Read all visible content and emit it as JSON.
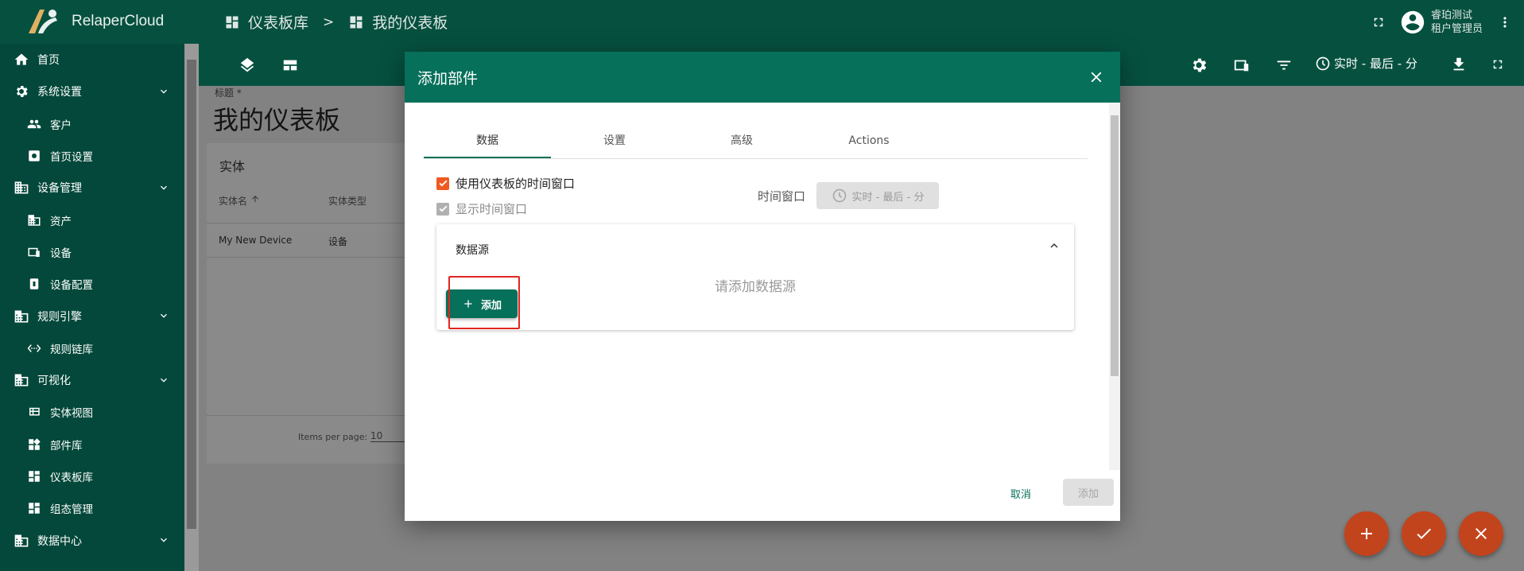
{
  "app": {
    "name": "RelaperCloud"
  },
  "breadcrumb": {
    "root": "仪表板库",
    "separator": ">",
    "current": "我的仪表板"
  },
  "user": {
    "name": "睿珀测试",
    "role": "租户管理员"
  },
  "sidebar": {
    "items": [
      {
        "label": "首页",
        "icon": "home-icon",
        "level": "top"
      },
      {
        "label": "系统设置",
        "icon": "gear-icon",
        "level": "top",
        "expandable": true
      },
      {
        "label": "客户",
        "icon": "people-icon",
        "level": "sub"
      },
      {
        "label": "首页设置",
        "icon": "gear-icon",
        "level": "sub"
      },
      {
        "label": "设备管理",
        "icon": "building-icon",
        "level": "top",
        "expandable": true
      },
      {
        "label": "资产",
        "icon": "building-icon",
        "level": "sub"
      },
      {
        "label": "设备",
        "icon": "devices-icon",
        "level": "sub"
      },
      {
        "label": "设备配置",
        "icon": "device-profile-icon",
        "level": "sub"
      },
      {
        "label": "规则引擎",
        "icon": "building-icon",
        "level": "top",
        "expandable": true
      },
      {
        "label": "规则链库",
        "icon": "code-icon",
        "level": "sub"
      },
      {
        "label": "可视化",
        "icon": "building-icon",
        "level": "top",
        "expandable": true
      },
      {
        "label": "实体视图",
        "icon": "view-icon",
        "level": "sub"
      },
      {
        "label": "部件库",
        "icon": "widgets-icon",
        "level": "sub"
      },
      {
        "label": "仪表板库",
        "icon": "dashboard-icon",
        "level": "sub"
      },
      {
        "label": "组态管理",
        "icon": "dashboard-icon",
        "level": "sub"
      },
      {
        "label": "数据中心",
        "icon": "building-icon",
        "level": "top",
        "expandable": true
      }
    ]
  },
  "dashboard": {
    "title_label": "标题 *",
    "title": "我的仪表板",
    "time_window_button": "实时 - 最后 - 分"
  },
  "entity_card": {
    "title": "实体",
    "columns": [
      "实体名",
      "实体类型"
    ],
    "rows": [
      [
        "My New Device",
        "设备"
      ]
    ],
    "paginator_label": "Items per page:",
    "page_size": "10"
  },
  "dialog": {
    "title": "添加部件",
    "tabs": [
      "数据",
      "设置",
      "高级",
      "Actions"
    ],
    "active_tab": 0,
    "use_dashboard_timewindow": {
      "label": "使用仪表板的时间窗口",
      "checked": true
    },
    "display_timewindow": {
      "label": "显示时间窗口",
      "checked": true,
      "disabled": true
    },
    "timewindow_label": "时间窗口",
    "timewindow_value": "实时 - 最后 - 分",
    "datasource": {
      "title": "数据源",
      "empty_text": "请添加数据源",
      "add_button": "添加"
    },
    "cancel_button": "取消",
    "add_button": "添加"
  },
  "colors": {
    "header": "#06503f",
    "dialog_header": "#06705a",
    "accent_orange": "#f05a22",
    "fab": "#c2441d",
    "highlight": "#e0261f"
  }
}
